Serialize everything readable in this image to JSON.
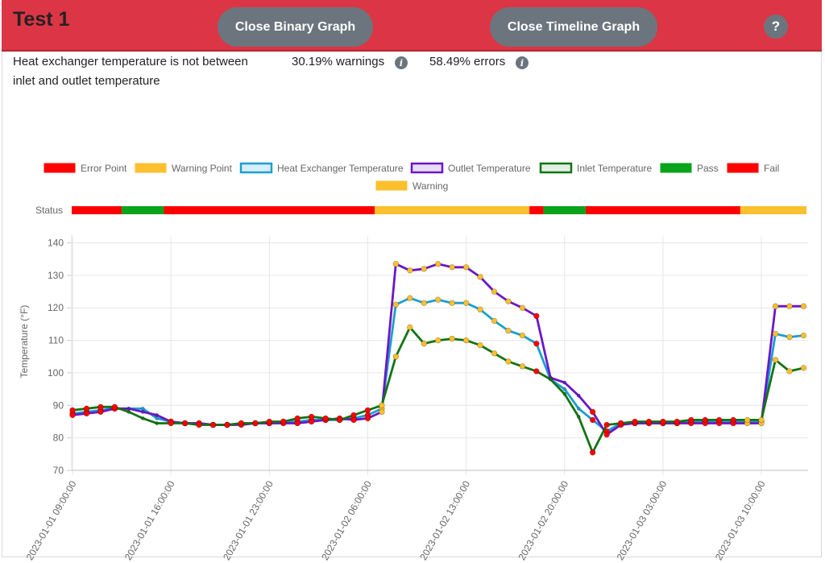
{
  "header": {
    "title": "Test 1",
    "close_binary_label": "Close Binary Graph",
    "close_timeline_label": "Close Timeline Graph",
    "help_label": "?"
  },
  "summary": {
    "description": "Heat exchanger temperature is not between inlet and outlet temperature",
    "warnings": "30.19% warnings",
    "errors": "58.49% errors",
    "info_glyph": "i"
  },
  "colors": {
    "header": "#dc3545",
    "error": "#ff0000",
    "warning": "#fbc02d",
    "heat_exchanger": "#1a9fd1",
    "outlet": "#6c16c7",
    "inlet": "#137313",
    "pass": "#0aa31b",
    "fail": "#ff0000"
  },
  "chart_data": {
    "type": "line",
    "legend": [
      {
        "label": "Error Point",
        "fill": "#ff0000",
        "stroke": "#ff0000"
      },
      {
        "label": "Warning Point",
        "fill": "#fbc02d",
        "stroke": "#fbc02d"
      },
      {
        "label": "Heat Exchanger Temperature",
        "fill": "#d6eef8",
        "stroke": "#1a9fd1"
      },
      {
        "label": "Outlet Temperature",
        "fill": "#e9dcf8",
        "stroke": "#6c16c7"
      },
      {
        "label": "Inlet Temperature",
        "fill": "#e3f0e3",
        "stroke": "#137313"
      },
      {
        "label": "Pass",
        "fill": "#0aa31b",
        "stroke": "#0aa31b"
      },
      {
        "label": "Fail",
        "fill": "#ff0000",
        "stroke": "#ff0000"
      },
      {
        "label": "Warning",
        "fill": "#fbc02d",
        "stroke": "#fbc02d"
      }
    ],
    "status_label": "Status",
    "status_segments": [
      {
        "from": 0,
        "to": 4,
        "state": "fail"
      },
      {
        "from": 4,
        "to": 7,
        "state": "pass"
      },
      {
        "from": 7,
        "to": 22,
        "state": "fail"
      },
      {
        "from": 22,
        "to": 33,
        "state": "warning"
      },
      {
        "from": 33,
        "to": 34,
        "state": "fail"
      },
      {
        "from": 34,
        "to": 37,
        "state": "pass"
      },
      {
        "from": 37,
        "to": 48,
        "state": "fail"
      },
      {
        "from": 48,
        "to": 52,
        "state": "warning"
      }
    ],
    "ylabel": "Temperature (°F)",
    "xlabel": "",
    "ylim": [
      70,
      140
    ],
    "yticks": [
      70,
      80,
      90,
      100,
      110,
      120,
      130,
      140
    ],
    "x_tick_labels": [
      {
        "index": 0,
        "label": "2023-01-01 09:00:00"
      },
      {
        "index": 7,
        "label": "2023-01-01 16:00:00"
      },
      {
        "index": 14,
        "label": "2023-01-01 23:00:00"
      },
      {
        "index": 21,
        "label": "2023-01-02 06:00:00"
      },
      {
        "index": 28,
        "label": "2023-01-02 13:00:00"
      },
      {
        "index": 35,
        "label": "2023-01-02 20:00:00"
      },
      {
        "index": 42,
        "label": "2023-01-03 03:00:00"
      },
      {
        "index": 49,
        "label": "2023-01-03 10:00:00"
      }
    ],
    "x_step": "1 hour",
    "point_status": [
      "e",
      "e",
      "e",
      "e",
      "p",
      "p",
      "p",
      "e",
      "e",
      "e",
      "e",
      "e",
      "e",
      "e",
      "e",
      "e",
      "e",
      "e",
      "e",
      "e",
      "e",
      "e",
      "w",
      "w",
      "w",
      "w",
      "w",
      "w",
      "w",
      "w",
      "w",
      "w",
      "w",
      "e",
      "p",
      "p",
      "p",
      "e",
      "e",
      "e",
      "e",
      "e",
      "e",
      "e",
      "e",
      "e",
      "e",
      "e",
      "w",
      "w",
      "w",
      "w",
      "w"
    ],
    "series": [
      {
        "name": "Heat Exchanger Temperature",
        "color": "#1a9fd1",
        "values": [
          87.5,
          88,
          88.5,
          89,
          89,
          89,
          86,
          85,
          84.5,
          84.5,
          84,
          84,
          84.5,
          84.5,
          84.5,
          85,
          85,
          85.5,
          85.5,
          85.5,
          86,
          87,
          89,
          121,
          123,
          121.5,
          122.5,
          121.5,
          121.5,
          119.5,
          116,
          113,
          111.5,
          109,
          98,
          95,
          89,
          85.5,
          82,
          84.5,
          84.5,
          84.5,
          84.5,
          84.5,
          85,
          85,
          85,
          85,
          85,
          85,
          112,
          111,
          111.5
        ]
      },
      {
        "name": "Outlet Temperature",
        "color": "#6c16c7",
        "values": [
          87,
          87.5,
          88,
          89,
          89,
          88,
          87,
          85,
          84.5,
          84.5,
          84,
          84,
          84,
          84.5,
          84.5,
          84.5,
          84.5,
          85,
          85.5,
          86,
          85.5,
          86,
          88,
          133.5,
          131.5,
          132,
          133.5,
          132.5,
          132.5,
          129.5,
          125,
          122,
          120,
          117.5,
          98.5,
          97,
          93,
          88,
          81,
          84,
          84.5,
          84.5,
          84.5,
          84.5,
          84.5,
          84.5,
          84.5,
          84.5,
          84.5,
          84.5,
          120.5,
          120.5,
          120.5
        ]
      },
      {
        "name": "Inlet Temperature",
        "color": "#137313",
        "values": [
          88.5,
          89,
          89.5,
          89.5,
          88,
          86,
          84.5,
          84.5,
          84.5,
          84,
          84,
          84,
          84.5,
          84.5,
          85,
          85,
          86,
          86.5,
          86,
          85.5,
          87,
          88.5,
          90,
          105,
          114,
          109,
          110,
          110.5,
          110,
          108.5,
          106,
          103.5,
          102,
          100.5,
          98,
          93.5,
          86.5,
          75.5,
          84,
          84.5,
          85,
          85,
          85,
          85,
          85.5,
          85.5,
          85.5,
          85.5,
          85.5,
          85.5,
          104,
          100.5,
          101.5
        ]
      }
    ]
  }
}
